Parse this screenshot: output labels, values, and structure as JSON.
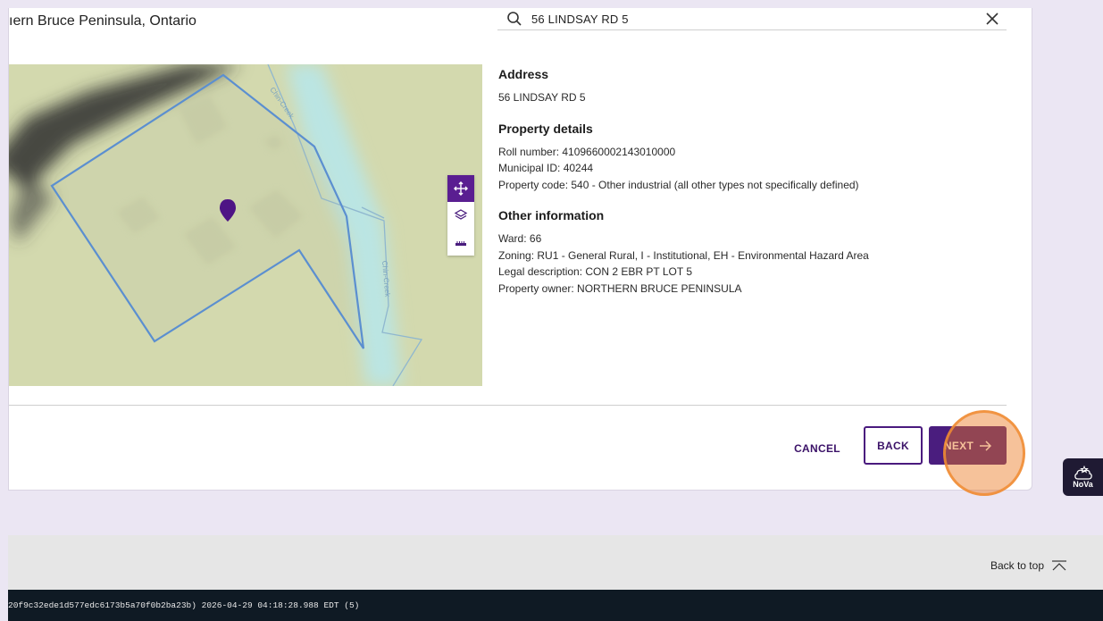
{
  "header": {
    "location_title": "ıern Bruce Peninsula, Ontario"
  },
  "search": {
    "value": "56 LINDSAY RD 5"
  },
  "map": {
    "creek_label": "Chin-Creek"
  },
  "address": {
    "heading": "Address",
    "value": "56 LINDSAY RD 5"
  },
  "property_details": {
    "heading": "Property details",
    "roll_number": "Roll number: 4109660002143010000",
    "municipal_id": "Municipal ID: 40244",
    "property_code": "Property code: 540 - Other industrial (all other types not specifically defined)"
  },
  "other_information": {
    "heading": "Other information",
    "ward": "Ward: 66",
    "zoning": "Zoning: RU1 - General Rural, I - Institutional, EH - Environmental Hazard Area",
    "legal_description": "Legal description: CON 2 EBR PT LOT 5",
    "property_owner": "Property owner: NORTHERN BRUCE PENINSULA"
  },
  "actions": {
    "cancel_label": "CANCEL",
    "back_label": "BACK",
    "next_label": "NEXT"
  },
  "nova": {
    "label": "NoVa"
  },
  "footer": {
    "back_to_top": "Back to top",
    "debug_text": "20f9c32ede1d577edc6173b5a70f0b2ba23b) 2026-04-29 04:18:28.988 EDT (5)"
  },
  "colors": {
    "brand_purple": "#4a1d7e",
    "page_background": "#ebe6f3",
    "parcel_outline": "#5b8fd0",
    "marker": "#4e1485"
  }
}
